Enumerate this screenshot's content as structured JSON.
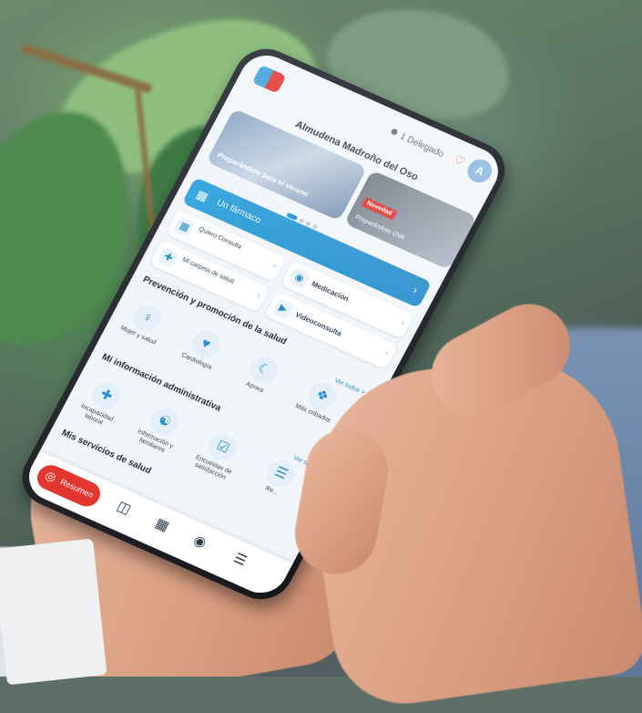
{
  "app": {
    "logo_caption": "",
    "delegate_label": "1 Delegado",
    "avatar_initial": "A",
    "greeting": "Almudena Madroño del Oso",
    "carousel": {
      "card_a_label": "Preparándote para el verano",
      "card_b_tag": "Novedad",
      "card_b_label": "Preparándote UVA"
    },
    "banner_label": "Un fármaco",
    "tiles": [
      {
        "label": "Quiero Consulta",
        "icon": "calendar-icon"
      },
      {
        "label": "Medicación",
        "icon": "pill-icon"
      },
      {
        "label": "Mi carpeta de salud",
        "icon": "folder-icon"
      },
      {
        "label": "Videoconsulta",
        "icon": "video-icon"
      }
    ],
    "section_prevention": "Prevención y promoción de la salud",
    "see_more_1": "Ver todos >",
    "quick_prevention": [
      "Mujer y salud",
      "Cardiología",
      "Apnea",
      "Más cribados"
    ],
    "section_admin": "Mi información administrativa",
    "see_more_2": "Ver todas >",
    "quick_admin": [
      "Incapacidad laboral",
      "Información y familiares",
      "Encuestas de satisfacción",
      "Re..."
    ],
    "section_services": "Mis servicios de salud",
    "bottom_nav": {
      "pill_label": "Resumen"
    }
  }
}
